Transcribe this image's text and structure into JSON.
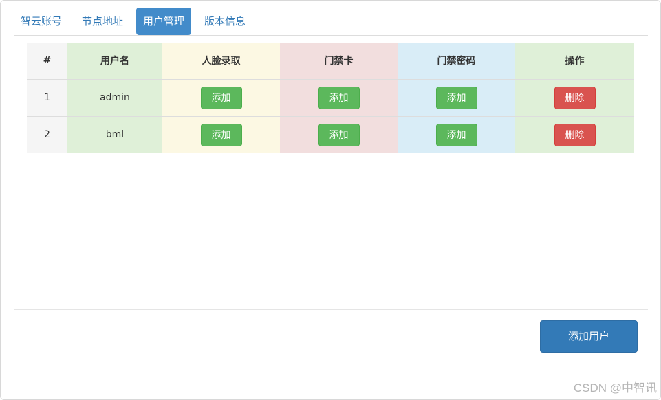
{
  "tabs": [
    "智云账号",
    "节点地址",
    "用户管理",
    "版本信息"
  ],
  "active_tab": "用户管理",
  "table": {
    "headers": [
      "#",
      "用户名",
      "人脸录取",
      "门禁卡",
      "门禁密码",
      "操作"
    ],
    "rows": [
      {
        "index": "1",
        "username": "admin",
        "face": "添加",
        "card": "添加",
        "password": "添加",
        "action": "删除"
      },
      {
        "index": "2",
        "username": "bml",
        "face": "添加",
        "card": "添加",
        "password": "添加",
        "action": "删除"
      }
    ]
  },
  "footer": {
    "add_user_label": "添加用户"
  },
  "watermark": "CSDN @中智讯",
  "colors": {
    "tab_active": "#428bca",
    "btn_success": "#5cb85c",
    "btn_danger": "#d9534f",
    "btn_primary": "#337ab7"
  }
}
